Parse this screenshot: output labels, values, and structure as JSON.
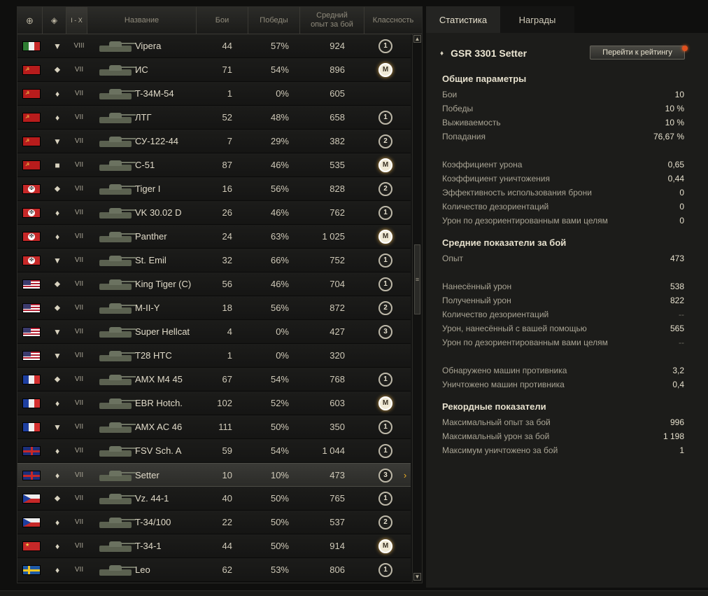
{
  "header": {
    "col_nation": "",
    "col_type": "",
    "col_tier": "I - X",
    "col_name": "Название",
    "col_battles": "Бои",
    "col_wins": "Победы",
    "col_avg_exp": "Средний\nопыт за бой",
    "col_class": "Классность"
  },
  "rows": [
    {
      "nation": "italy",
      "type": "▼",
      "tier": "VIII",
      "name": "Vipera",
      "battles": "44",
      "wins": "57%",
      "avg_exp": "924",
      "class": "1"
    },
    {
      "nation": "ussr",
      "type": "⬥",
      "tier": "VII",
      "name": "ИС",
      "battles": "71",
      "wins": "54%",
      "avg_exp": "896",
      "class": "M"
    },
    {
      "nation": "ussr",
      "type": "♦",
      "tier": "VII",
      "name": "T-34M-54",
      "battles": "1",
      "wins": "0%",
      "avg_exp": "605",
      "class": ""
    },
    {
      "nation": "ussr",
      "type": "♦",
      "tier": "VII",
      "name": "ЛТГ",
      "battles": "52",
      "wins": "48%",
      "avg_exp": "658",
      "class": "1"
    },
    {
      "nation": "ussr",
      "type": "▼",
      "tier": "VII",
      "name": "СУ-122-44",
      "battles": "7",
      "wins": "29%",
      "avg_exp": "382",
      "class": "2"
    },
    {
      "nation": "ussr",
      "type": "■",
      "tier": "VII",
      "name": "С-51",
      "battles": "87",
      "wins": "46%",
      "avg_exp": "535",
      "class": "M"
    },
    {
      "nation": "germany",
      "type": "⬥",
      "tier": "VII",
      "name": "Tiger I",
      "battles": "16",
      "wins": "56%",
      "avg_exp": "828",
      "class": "2"
    },
    {
      "nation": "germany",
      "type": "♦",
      "tier": "VII",
      "name": "VK 30.02 D",
      "battles": "26",
      "wins": "46%",
      "avg_exp": "762",
      "class": "1"
    },
    {
      "nation": "germany",
      "type": "♦",
      "tier": "VII",
      "name": "Panther",
      "battles": "24",
      "wins": "63%",
      "avg_exp": "1 025",
      "class": "M"
    },
    {
      "nation": "germany",
      "type": "▼",
      "tier": "VII",
      "name": "St. Emil",
      "battles": "32",
      "wins": "66%",
      "avg_exp": "752",
      "class": "1"
    },
    {
      "nation": "usa",
      "type": "⬥",
      "tier": "VII",
      "name": "King Tiger (C)",
      "battles": "56",
      "wins": "46%",
      "avg_exp": "704",
      "class": "1"
    },
    {
      "nation": "usa",
      "type": "⬥",
      "tier": "VII",
      "name": "M-II-Y",
      "battles": "18",
      "wins": "56%",
      "avg_exp": "872",
      "class": "2"
    },
    {
      "nation": "usa",
      "type": "▼",
      "tier": "VII",
      "name": "Super Hellcat",
      "battles": "4",
      "wins": "0%",
      "avg_exp": "427",
      "class": "3"
    },
    {
      "nation": "usa",
      "type": "▼",
      "tier": "VII",
      "name": "T28 HTC",
      "battles": "1",
      "wins": "0%",
      "avg_exp": "320",
      "class": ""
    },
    {
      "nation": "france",
      "type": "⬥",
      "tier": "VII",
      "name": "AMX M4 45",
      "battles": "67",
      "wins": "54%",
      "avg_exp": "768",
      "class": "1"
    },
    {
      "nation": "france",
      "type": "♦",
      "tier": "VII",
      "name": "EBR Hotch.",
      "battles": "102",
      "wins": "52%",
      "avg_exp": "603",
      "class": "M"
    },
    {
      "nation": "france",
      "type": "▼",
      "tier": "VII",
      "name": "AMX AC 46",
      "battles": "111",
      "wins": "50%",
      "avg_exp": "350",
      "class": "1"
    },
    {
      "nation": "uk",
      "type": "♦",
      "tier": "VII",
      "name": "FSV Sch. A",
      "battles": "59",
      "wins": "54%",
      "avg_exp": "1 044",
      "class": "1"
    },
    {
      "nation": "uk",
      "type": "♦",
      "tier": "VII",
      "name": "Setter",
      "battles": "10",
      "wins": "10%",
      "avg_exp": "473",
      "class": "3",
      "selected": true
    },
    {
      "nation": "czech",
      "type": "⬥",
      "tier": "VII",
      "name": "Vz. 44-1",
      "battles": "40",
      "wins": "50%",
      "avg_exp": "765",
      "class": "1"
    },
    {
      "nation": "czech",
      "type": "♦",
      "tier": "VII",
      "name": "T-34/100",
      "battles": "22",
      "wins": "50%",
      "avg_exp": "537",
      "class": "2"
    },
    {
      "nation": "china",
      "type": "♦",
      "tier": "VII",
      "name": "T-34-1",
      "battles": "44",
      "wins": "50%",
      "avg_exp": "914",
      "class": "M"
    },
    {
      "nation": "sweden",
      "type": "♦",
      "tier": "VII",
      "name": "Leo",
      "battles": "62",
      "wins": "53%",
      "avg_exp": "806",
      "class": "1"
    }
  ],
  "tabs": [
    "Статистика",
    "Награды"
  ],
  "vehicle": {
    "title": "GSR 3301 Setter",
    "rating_button": "Перейти к рейтингу"
  },
  "stats": {
    "general_title": "Общие параметры",
    "general": [
      {
        "label": "Бои",
        "value": "10"
      },
      {
        "label": "Победы",
        "value": "10 %"
      },
      {
        "label": "Выживаемость",
        "value": "10 %"
      },
      {
        "label": "Попадания",
        "value": "76,67 %"
      }
    ],
    "coef": [
      {
        "label": "Коэффициент урона",
        "value": "0,65"
      },
      {
        "label": "Коэффициент уничтожения",
        "value": "0,44"
      },
      {
        "label": "Эффективность использования брони",
        "value": "0"
      },
      {
        "label": "Количество дезориентаций",
        "value": "0"
      },
      {
        "label": "Урон по дезориентированным вами целям",
        "value": "0"
      }
    ],
    "average_title": "Средние показатели за бой",
    "average_exp": [
      {
        "label": "Опыт",
        "value": "473"
      }
    ],
    "average_damage": [
      {
        "label": "Нанесённый урон",
        "value": "538"
      },
      {
        "label": "Полученный урон",
        "value": "822"
      },
      {
        "label": "Количество дезориентаций",
        "value": "--"
      },
      {
        "label": "Урон, нанесённый с вашей помощью",
        "value": "565"
      },
      {
        "label": "Урон по дезориентированным вами целям",
        "value": "--"
      }
    ],
    "average_spot": [
      {
        "label": "Обнаружено машин противника",
        "value": "3,2"
      },
      {
        "label": "Уничтожено машин противника",
        "value": "0,4"
      }
    ],
    "record_title": "Рекордные показатели",
    "record": [
      {
        "label": "Максимальный опыт за бой",
        "value": "996"
      },
      {
        "label": "Максимальный урон за бой",
        "value": "1 198"
      },
      {
        "label": "Максимум уничтожено за бой",
        "value": "1"
      }
    ]
  }
}
